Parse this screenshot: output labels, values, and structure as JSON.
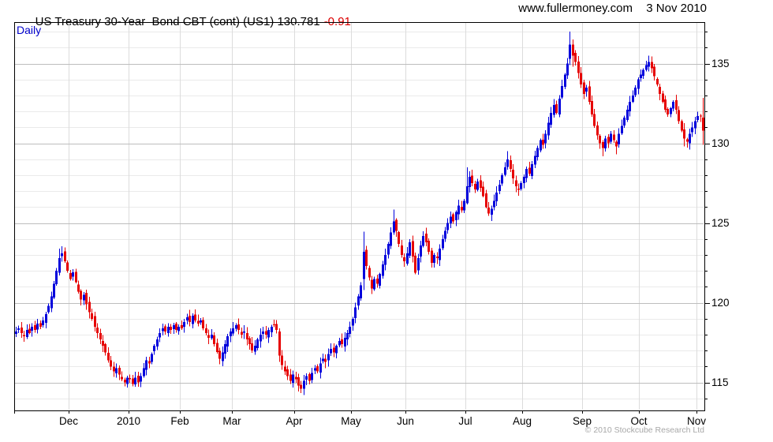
{
  "header": {
    "title": "US Treasury 30-Year  Bond CBT (cont) (US1) 130.781",
    "change": "-0.91",
    "site": "www.fullermoney.com",
    "date": "3 Nov 2010"
  },
  "plot": {
    "frequency_label": "Daily"
  },
  "footer": {
    "copyright": "© 2010 Stockcube Research Ltd"
  },
  "chart_data": {
    "type": "candlestick",
    "title": "US Treasury 30-Year Bond CBT (cont) (US1)",
    "frequency": "Daily",
    "last_price": 130.781,
    "change": -0.91,
    "date": "3 Nov 2010",
    "x_axis": {
      "labels": [
        "Dec",
        "2010",
        "Feb",
        "Mar",
        "Apr",
        "May",
        "Jun",
        "Jul",
        "Aug",
        "Sep",
        "Oct",
        "Nov"
      ],
      "boundary_day_index": [
        20,
        42,
        61,
        80,
        103,
        124,
        144,
        166,
        187,
        209,
        230,
        251
      ]
    },
    "y_axis": {
      "ylim": [
        113.25,
        137.6
      ],
      "tick_step": 1,
      "label_step": 5,
      "labels": [
        "115",
        "120",
        "125",
        "130",
        "135"
      ],
      "label_values": [
        115,
        120,
        125,
        130,
        135
      ]
    },
    "grid": {
      "minor_color": "#eaeaea",
      "major_color": "#bdbdbd",
      "vertical_color": "#dcdcdc",
      "border_color": "#000000"
    },
    "colors": {
      "up": "#0000dc",
      "down": "#e60000"
    },
    "days": 254,
    "closes": [
      118.2,
      118.4,
      118.1,
      117.9,
      118.3,
      118.1,
      118.5,
      118.3,
      118.7,
      118.5,
      118.9,
      119.3,
      119.8,
      120.4,
      121.2,
      122.0,
      122.8,
      123.1,
      122.6,
      122.0,
      121.5,
      121.9,
      121.3,
      120.7,
      120.2,
      120.5,
      119.9,
      119.4,
      119.0,
      118.5,
      118.1,
      117.7,
      117.3,
      116.9,
      116.4,
      116.0,
      115.7,
      115.9,
      115.5,
      115.2,
      115.0,
      115.3,
      115.2,
      114.9,
      115.3,
      115.0,
      115.4,
      115.9,
      116.4,
      116.2,
      116.8,
      117.3,
      117.7,
      118.1,
      118.4,
      118.2,
      118.5,
      118.3,
      118.6,
      118.3,
      118.5,
      118.4,
      118.8,
      119.1,
      118.8,
      119.2,
      118.9,
      118.7,
      118.9,
      118.4,
      118.1,
      117.8,
      118.0,
      117.4,
      116.9,
      116.5,
      116.9,
      117.4,
      117.9,
      118.2,
      118.4,
      118.6,
      118.3,
      118.0,
      118.2,
      117.7,
      117.4,
      117.0,
      117.3,
      117.7,
      118.0,
      118.2,
      118.0,
      118.3,
      118.5,
      118.6,
      118.3,
      116.7,
      116.1,
      115.7,
      115.4,
      115.1,
      115.5,
      115.2,
      114.8,
      114.6,
      115.1,
      115.4,
      115.1,
      115.6,
      115.9,
      115.7,
      116.2,
      116.5,
      116.3,
      116.8,
      117.1,
      116.9,
      117.3,
      117.6,
      117.4,
      117.8,
      118.1,
      118.5,
      119.0,
      119.7,
      120.4,
      121.1,
      123.2,
      122.3,
      121.6,
      120.9,
      121.5,
      121.2,
      121.8,
      122.4,
      123.0,
      123.7,
      124.4,
      125.1,
      124.5,
      123.7,
      123.0,
      122.6,
      123.1,
      123.8,
      122.9,
      121.9,
      122.8,
      123.6,
      124.2,
      123.8,
      123.2,
      122.5,
      123.0,
      122.8,
      123.4,
      124.0,
      124.5,
      125.0,
      125.4,
      125.1,
      125.7,
      126.1,
      125.8,
      126.4,
      127.3,
      127.9,
      127.5,
      127.1,
      127.6,
      127.2,
      126.7,
      126.0,
      125.6,
      125.9,
      126.4,
      126.9,
      127.4,
      128.0,
      128.5,
      129.0,
      128.4,
      127.8,
      127.3,
      127.1,
      127.5,
      127.9,
      128.4,
      128.1,
      128.7,
      129.2,
      129.7,
      130.2,
      129.9,
      130.6,
      131.3,
      131.9,
      132.4,
      131.9,
      132.8,
      133.6,
      134.3,
      135.0,
      136.2,
      135.5,
      135.1,
      134.4,
      133.7,
      133.1,
      133.5,
      132.6,
      131.8,
      131.1,
      130.5,
      130.0,
      129.7,
      130.3,
      130.0,
      130.6,
      130.2,
      129.8,
      130.6,
      131.1,
      131.6,
      132.1,
      132.6,
      133.0,
      133.5,
      134.0,
      134.3,
      134.6,
      134.9,
      135.1,
      134.7,
      134.2,
      133.7,
      133.1,
      132.6,
      132.1,
      131.8,
      132.2,
      132.6,
      132.1,
      131.4,
      130.8,
      130.3,
      130.1,
      130.6,
      131.0,
      131.4,
      131.7,
      131.691,
      130.781
    ],
    "overrides": {
      "16": {
        "h": 123.4
      },
      "17": {
        "h": 123.55
      },
      "97": {
        "o": 118.2,
        "h": 118.4,
        "l": 116.3
      },
      "101": {
        "l": 114.9
      },
      "105": {
        "l": 114.35
      },
      "128": {
        "o": 121.5,
        "h": 124.45,
        "l": 120.8
      },
      "139": {
        "h": 125.85
      },
      "166": {
        "h": 128.5
      },
      "181": {
        "h": 129.5
      },
      "204": {
        "o": 135.3,
        "h": 137.0,
        "l": 134.9
      },
      "205": {
        "h": 136.5,
        "l": 134.8
      },
      "216": {
        "l": 129.2
      },
      "221": {
        "l": 129.3
      },
      "233": {
        "h": 135.5
      },
      "246": {
        "l": 129.8
      },
      "253": {
        "o": 131.6,
        "h": 132.85,
        "l": 129.9
      }
    },
    "noise": {
      "seed": 11,
      "wick": 0.32,
      "open": 0.16
    }
  }
}
